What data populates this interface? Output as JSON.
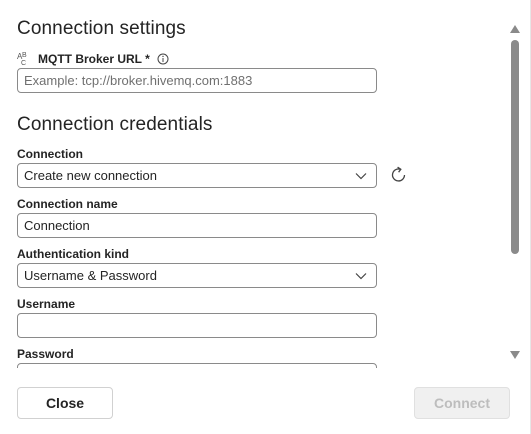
{
  "sections": {
    "settings_title": "Connection settings",
    "credentials_title": "Connection credentials"
  },
  "broker_url": {
    "label": "MQTT Broker URL *",
    "placeholder": "Example: tcp://broker.hivemq.com:1883",
    "value": ""
  },
  "connection": {
    "label": "Connection",
    "selected": "Create new connection"
  },
  "connection_name": {
    "label": "Connection name",
    "value": "Connection"
  },
  "auth_kind": {
    "label": "Authentication kind",
    "selected": "Username & Password"
  },
  "username": {
    "label": "Username",
    "value": ""
  },
  "password": {
    "label": "Password"
  },
  "footer": {
    "close_label": "Close",
    "connect_label": "Connect"
  },
  "icons": {
    "type": "abc-text-type-icon",
    "info": "info-icon",
    "refresh": "refresh-icon",
    "chevron": "chevron-down-icon"
  },
  "colors": {
    "text": "#242424",
    "border": "#8a8a8a",
    "disabled_text": "#bdbdbd",
    "disabled_bg": "#f0f0f0"
  }
}
